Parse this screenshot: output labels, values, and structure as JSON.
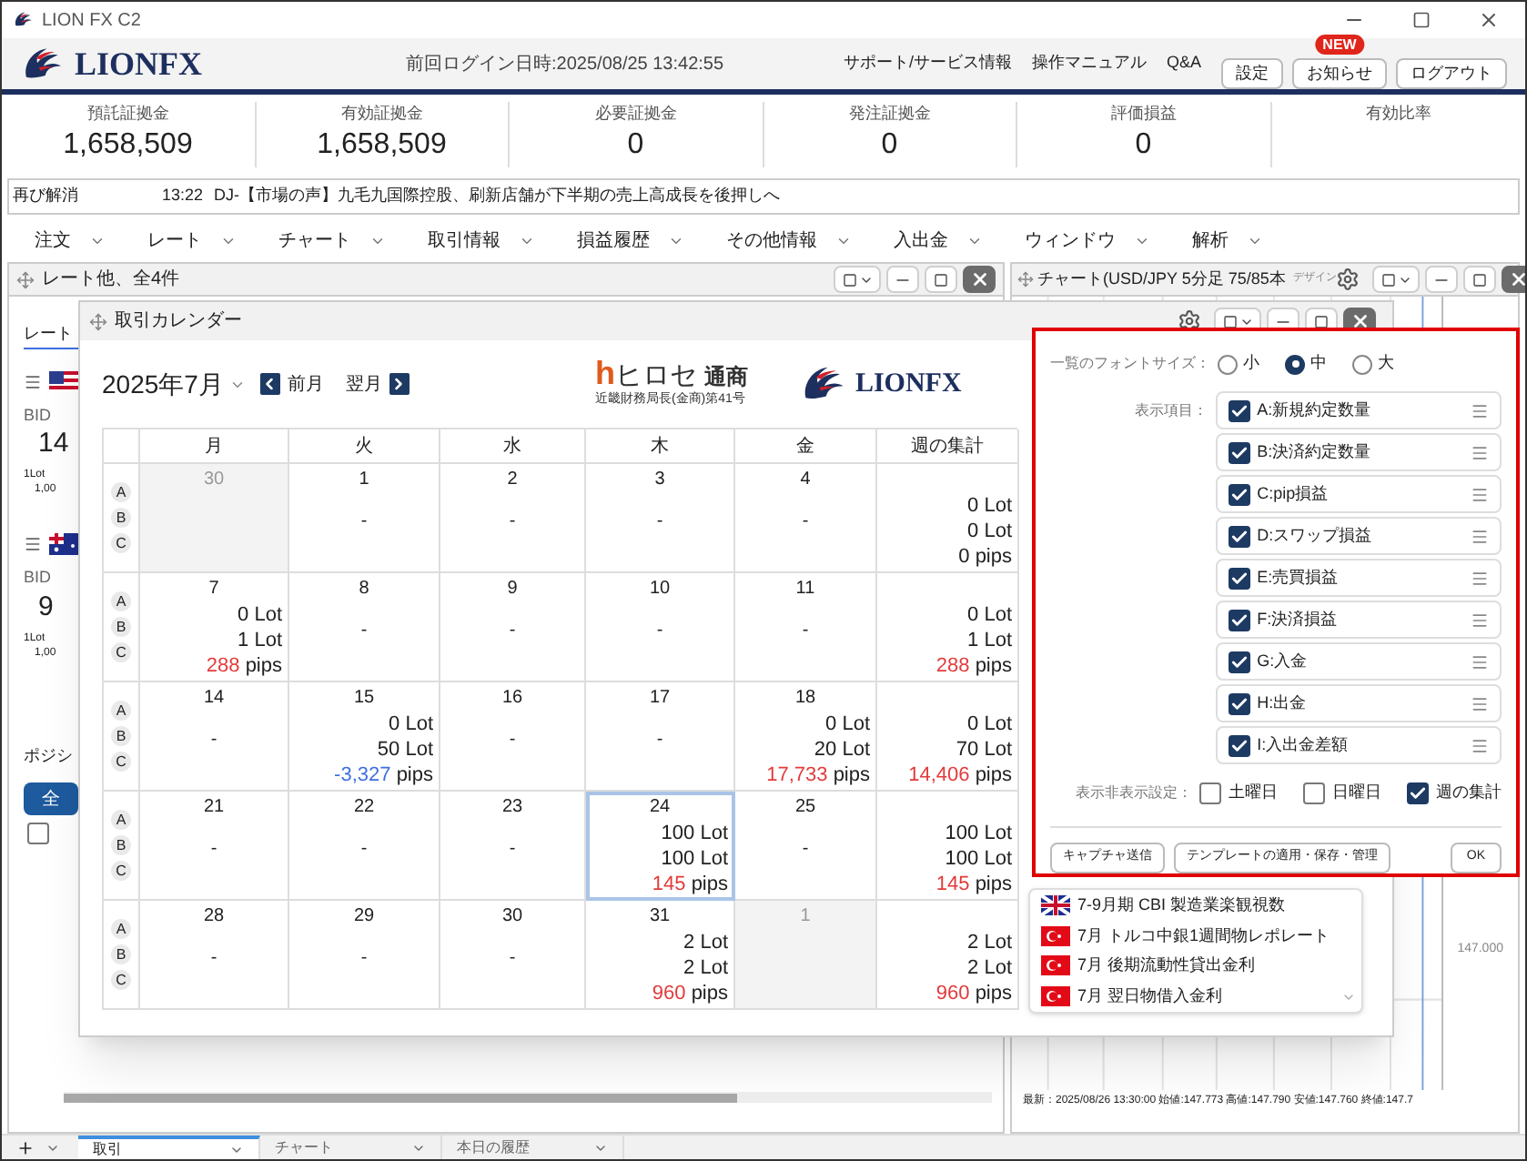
{
  "window": {
    "title": "LION FX C2"
  },
  "header": {
    "logo": "LIONFX",
    "last_login": "前回ログイン日時:2025/08/25 13:42:55",
    "links": [
      "サポート/サービス情報",
      "操作マニュアル",
      "Q&A"
    ],
    "buttons": [
      {
        "label": "設定"
      },
      {
        "label": "お知らせ",
        "badge": "NEW"
      },
      {
        "label": "ログアウト"
      }
    ]
  },
  "summary": [
    {
      "label": "預託証拠金",
      "value": "1,658,509"
    },
    {
      "label": "有効証拠金",
      "value": "1,658,509"
    },
    {
      "label": "必要証拠金",
      "value": "0"
    },
    {
      "label": "発注証拠金",
      "value": "0"
    },
    {
      "label": "評価損益",
      "value": "0"
    },
    {
      "label": "有効比率"
    }
  ],
  "ticker": {
    "category": "再び解消",
    "time": "13:22",
    "headline": "DJ-【市場の声】九毛九国際控股、刷新店舗が下半期の売上高成長を後押しへ"
  },
  "menu": [
    "注文",
    "レート",
    "チャート",
    "取引情報",
    "損益履歴",
    "その他情報",
    "入出金",
    "ウィンドウ",
    "解析"
  ],
  "rate_panel": {
    "title": "レート他、全4件",
    "tab": "レート",
    "pairs": [
      {
        "kind": "us",
        "bid_label": "BID",
        "bid": "14",
        "lot": "1Lot",
        "amount": "1,00"
      },
      {
        "kind": "au",
        "bid_label": "BID",
        "bid": "9",
        "lot": "1Lot",
        "amount": "1,00"
      }
    ],
    "position_label": "ポジシ",
    "all_button": "全",
    "select_all": false
  },
  "chart_panel": {
    "title": "チャート(USD/JPY 5分足 75/85本",
    "design_label": "デザイン",
    "price_label": "147.000",
    "status": "最新：2025/08/26 13:30:00 始値:147.773 高値:147.790 安値:147.760 終値:147.7"
  },
  "calendar": {
    "title": "取引カレンダー",
    "month": "2025年7月",
    "prev": "前月",
    "next": "翌月",
    "brand": {
      "mark": "h",
      "name": "ヒロセ",
      "suffix": "通商",
      "license": "近畿財務局長(金商)第41号"
    },
    "partner": "LIONFX",
    "columns": [
      "月",
      "火",
      "水",
      "木",
      "金",
      "週の集計"
    ],
    "weeks": [
      {
        "labels": [
          "A",
          "B",
          "C"
        ],
        "days": [
          {
            "date": "30",
            "other_month": true,
            "selected": false
          },
          {
            "date": "1",
            "other_month": false,
            "selected": false,
            "dash": "-"
          },
          {
            "date": "2",
            "other_month": false,
            "selected": false,
            "dash": "-"
          },
          {
            "date": "3",
            "other_month": false,
            "selected": false,
            "dash": "-"
          },
          {
            "date": "4",
            "other_month": false,
            "selected": false,
            "dash": "-"
          }
        ],
        "total": [
          {
            "value": "0",
            "unit": "Lot",
            "color": "#222222"
          },
          {
            "value": "0",
            "unit": "Lot",
            "color": "#222222"
          },
          {
            "value": "0",
            "unit": "pips",
            "color": "#222222"
          }
        ]
      },
      {
        "labels": [
          "A",
          "B",
          "C"
        ],
        "days": [
          {
            "date": "7",
            "other_month": false,
            "selected": false,
            "entries": [
              {
                "value": "0",
                "unit": "Lot",
                "color": "#222222"
              },
              {
                "value": "1",
                "unit": "Lot",
                "color": "#222222"
              },
              {
                "value": "288",
                "unit": "pips",
                "color": "#e23b3b"
              }
            ]
          },
          {
            "date": "8",
            "other_month": false,
            "selected": false,
            "dash": "-"
          },
          {
            "date": "9",
            "other_month": false,
            "selected": false,
            "dash": "-"
          },
          {
            "date": "10",
            "other_month": false,
            "selected": false,
            "dash": "-"
          },
          {
            "date": "11",
            "other_month": false,
            "selected": false,
            "dash": "-"
          }
        ],
        "total": [
          {
            "value": "0",
            "unit": "Lot",
            "color": "#222222"
          },
          {
            "value": "1",
            "unit": "Lot",
            "color": "#222222"
          },
          {
            "value": "288",
            "unit": "pips",
            "color": "#e23b3b"
          }
        ]
      },
      {
        "labels": [
          "A",
          "B",
          "C"
        ],
        "days": [
          {
            "date": "14",
            "other_month": false,
            "selected": false,
            "dash": "-"
          },
          {
            "date": "15",
            "other_month": false,
            "selected": false,
            "entries": [
              {
                "value": "0",
                "unit": "Lot",
                "color": "#222222"
              },
              {
                "value": "50",
                "unit": "Lot",
                "color": "#222222"
              },
              {
                "value": "-3,327",
                "unit": "pips",
                "color": "#3d6fe0"
              }
            ]
          },
          {
            "date": "16",
            "other_month": false,
            "selected": false,
            "dash": "-"
          },
          {
            "date": "17",
            "other_month": false,
            "selected": false,
            "dash": "-"
          },
          {
            "date": "18",
            "other_month": false,
            "selected": false,
            "entries": [
              {
                "value": "0",
                "unit": "Lot",
                "color": "#222222"
              },
              {
                "value": "20",
                "unit": "Lot",
                "color": "#222222"
              },
              {
                "value": "17,733",
                "unit": "pips",
                "color": "#e23b3b"
              }
            ]
          }
        ],
        "total": [
          {
            "value": "0",
            "unit": "Lot",
            "color": "#222222"
          },
          {
            "value": "70",
            "unit": "Lot",
            "color": "#222222"
          },
          {
            "value": "14,406",
            "unit": "pips",
            "color": "#e23b3b"
          }
        ]
      },
      {
        "labels": [
          "A",
          "B",
          "C"
        ],
        "days": [
          {
            "date": "21",
            "other_month": false,
            "selected": false,
            "dash": "-"
          },
          {
            "date": "22",
            "other_month": false,
            "selected": false,
            "dash": "-"
          },
          {
            "date": "23",
            "other_month": false,
            "selected": false,
            "dash": "-"
          },
          {
            "date": "24",
            "other_month": false,
            "selected": true,
            "entries": [
              {
                "value": "100",
                "unit": "Lot",
                "color": "#222222"
              },
              {
                "value": "100",
                "unit": "Lot",
                "color": "#222222"
              },
              {
                "value": "145",
                "unit": "pips",
                "color": "#e23b3b"
              }
            ]
          },
          {
            "date": "25",
            "other_month": false,
            "selected": false,
            "dash": "-"
          }
        ],
        "total": [
          {
            "value": "100",
            "unit": "Lot",
            "color": "#222222"
          },
          {
            "value": "100",
            "unit": "Lot",
            "color": "#222222"
          },
          {
            "value": "145",
            "unit": "pips",
            "color": "#e23b3b"
          }
        ]
      },
      {
        "labels": [
          "A",
          "B",
          "C"
        ],
        "days": [
          {
            "date": "28",
            "other_month": false,
            "selected": false,
            "dash": "-"
          },
          {
            "date": "29",
            "other_month": false,
            "selected": false,
            "dash": "-"
          },
          {
            "date": "30",
            "other_month": false,
            "selected": false,
            "dash": "-"
          },
          {
            "date": "31",
            "other_month": false,
            "selected": false,
            "entries": [
              {
                "value": "2",
                "unit": "Lot",
                "color": "#222222"
              },
              {
                "value": "2",
                "unit": "Lot",
                "color": "#222222"
              },
              {
                "value": "960",
                "unit": "pips",
                "color": "#e23b3b"
              }
            ]
          },
          {
            "date": "1",
            "other_month": true,
            "selected": false
          }
        ],
        "total": [
          {
            "value": "2",
            "unit": "Lot",
            "color": "#222222"
          },
          {
            "value": "2",
            "unit": "Lot",
            "color": "#222222"
          },
          {
            "value": "960",
            "unit": "pips",
            "color": "#e23b3b"
          }
        ]
      }
    ],
    "events": [
      {
        "kind": "gb",
        "text": "7-9月期 CBI 製造業楽観視数"
      },
      {
        "kind": "tr",
        "text": "7月 トルコ中銀1週間物レポレート"
      },
      {
        "kind": "tr",
        "text": "7月 後期流動性貸出金利"
      },
      {
        "kind": "tr",
        "text": "7月 翌日物借入金利"
      }
    ]
  },
  "settings": {
    "font_size_label": "一覧のフォントサイズ：",
    "font_sizes": [
      {
        "label": "小",
        "selected": false
      },
      {
        "label": "中",
        "selected": true
      },
      {
        "label": "大",
        "selected": false
      }
    ],
    "items_label": "表示項目：",
    "items": [
      {
        "label": "A:新規約定数量",
        "checked": true
      },
      {
        "label": "B:決済約定数量",
        "checked": true
      },
      {
        "label": "C:pip損益",
        "checked": true
      },
      {
        "label": "D:スワップ損益",
        "checked": true
      },
      {
        "label": "E:売買損益",
        "checked": true
      },
      {
        "label": "F:決済損益",
        "checked": true
      },
      {
        "label": "G:入金",
        "checked": true
      },
      {
        "label": "H:出金",
        "checked": true
      },
      {
        "label": "I:入出金差額",
        "checked": true
      }
    ],
    "visibility_label": "表示非表示設定：",
    "visibility": [
      {
        "label": "土曜日",
        "checked": false
      },
      {
        "label": "日曜日",
        "checked": false
      },
      {
        "label": "週の集計",
        "checked": true
      }
    ],
    "buttons": [
      {
        "label": "キャプチャ送信",
        "kind": "left"
      },
      {
        "label": "テンプレートの適用・保存・管理",
        "kind": "left"
      },
      {
        "label": "OK",
        "kind": "right"
      }
    ]
  },
  "bottom_tabs": [
    {
      "label": "取引",
      "selected": true
    },
    {
      "label": "チャート",
      "selected": false
    },
    {
      "label": "本日の履歴",
      "selected": false
    }
  ]
}
